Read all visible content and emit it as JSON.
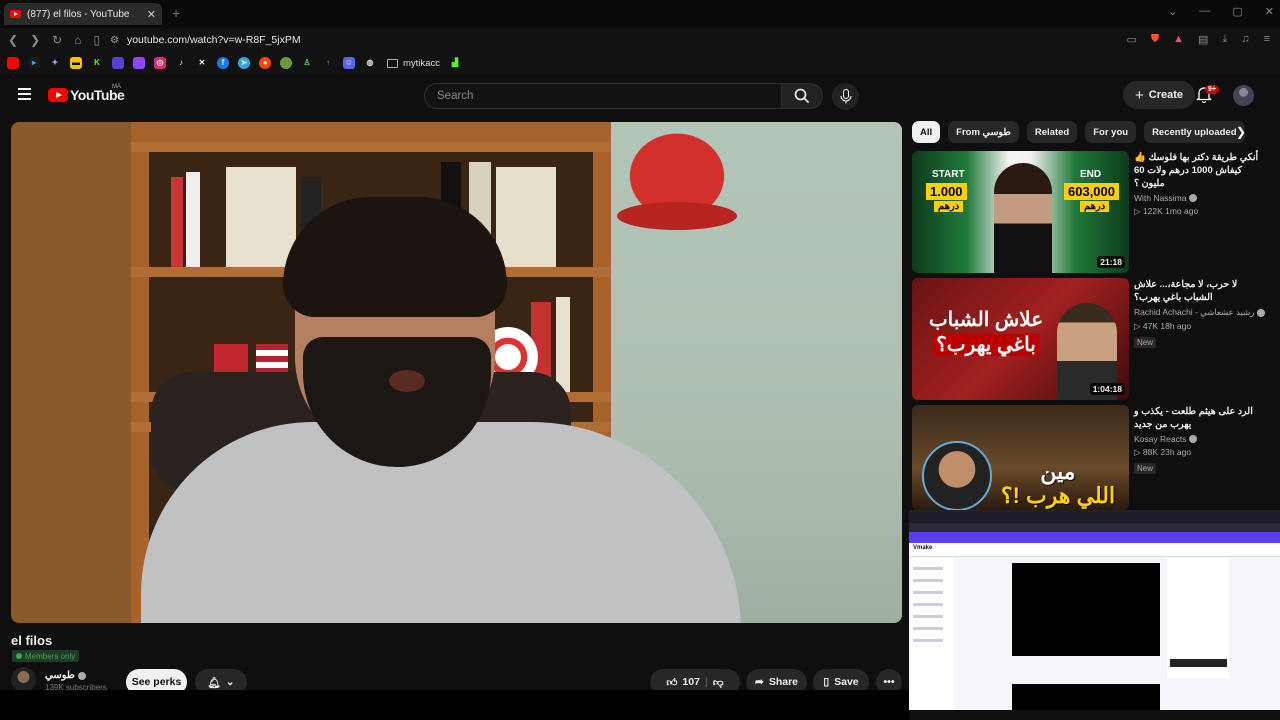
{
  "browser": {
    "tab_title": "(877) el filos - YouTube",
    "tab_close": "✕",
    "new_tab": "+",
    "url": "youtube.com/watch?v=w-R8F_5jxPM",
    "bookmark_folder": "mytikacc"
  },
  "header": {
    "logo_text": "YouTube",
    "country_code": "MA",
    "search_placeholder": "Search",
    "create_label": "Create",
    "notif_count": "9+"
  },
  "video": {
    "title": "el filos",
    "members_only": "Members only",
    "channel_name": "طوسي",
    "subscribers": "139K subscribers",
    "see_perks": "See perks",
    "likes": "107",
    "share": "Share",
    "save": "Save"
  },
  "chips": [
    "All",
    "From طوسي",
    "Related",
    "For you",
    "Recently uploaded"
  ],
  "recommendations": [
    {
      "title": "أنكي طريقة دكتر بها فلوسك 👍 كيفاش 1000 درهم ولات 60 مليون ؟",
      "channel": "With Nassima",
      "meta": "▷ 122K  1mo ago",
      "duration": "21:18",
      "new": "",
      "thumb_start": "START",
      "thumb_end": "END",
      "thumb_num1": "1.000",
      "thumb_num2": "603,000",
      "thumb_currency": "درهم"
    },
    {
      "title": "لا حرب، لا مجاعة،... علاش الشباب باغي يهرب؟",
      "channel": "Rachid Achachi - رشيد عشعاشي",
      "meta": "▷ 47K  18h ago",
      "duration": "1:04:18",
      "new": "New",
      "thumb_line1": "علاش الشباب",
      "thumb_line2": "باغي يهرب؟"
    },
    {
      "title": "الرد على هيثم طلعت - يكذب و يهرب من جديد",
      "channel": "Kosay Reacts",
      "meta": "▷ 88K  23h ago",
      "duration": "",
      "new": "New",
      "thumb_line1": "مين",
      "thumb_line2": "اللي هرب !؟"
    }
  ],
  "overlay": {
    "app_name": "Vmake"
  },
  "colors": {
    "brand_red": "#ff0000",
    "background": "#0f0f0f",
    "members_green": "#3ea55f"
  }
}
